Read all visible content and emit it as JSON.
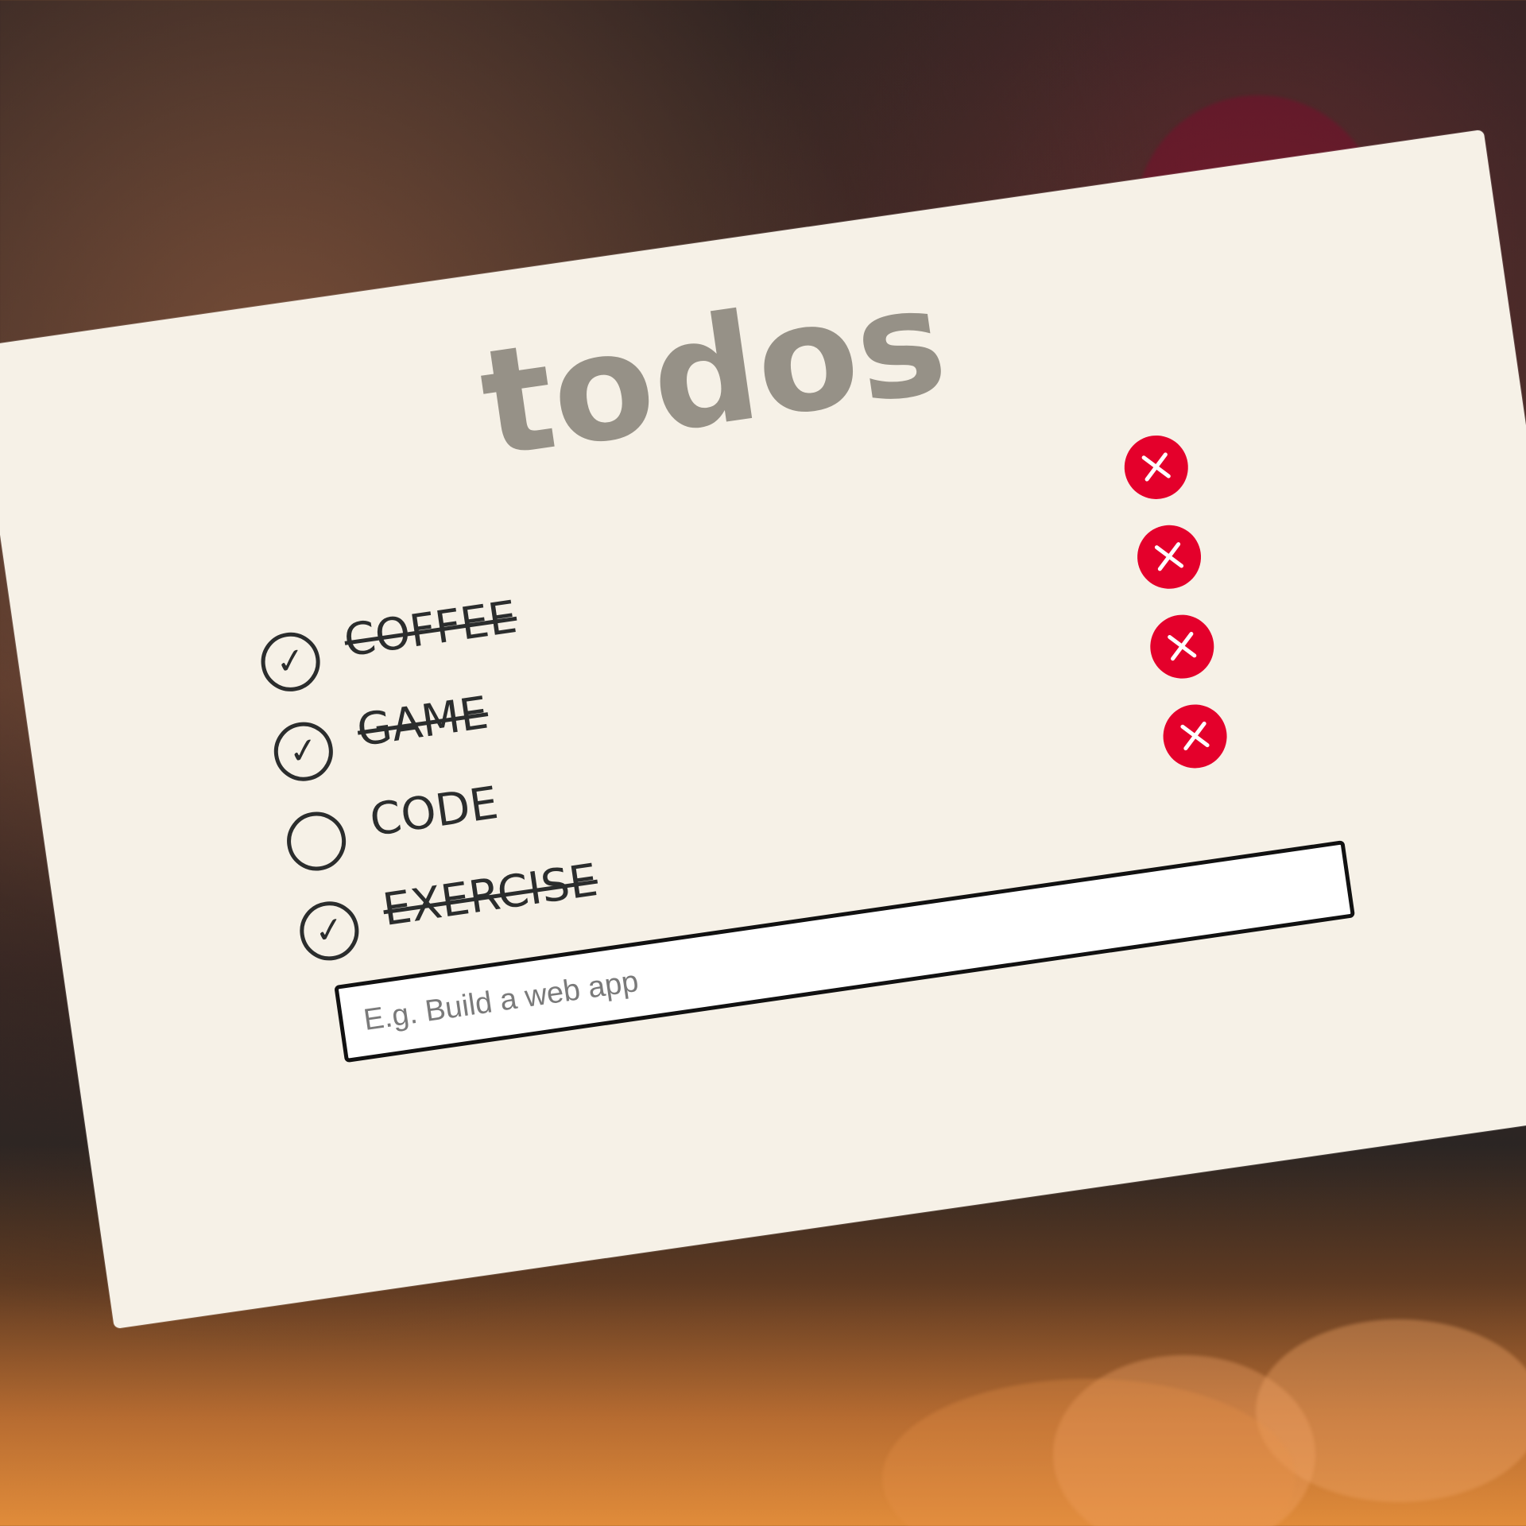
{
  "app": {
    "title": "todos"
  },
  "todos": [
    {
      "label": "COFFEE",
      "completed": true,
      "check_icon": "checkmark-icon",
      "delete_icon": "close-icon"
    },
    {
      "label": "GAME",
      "completed": true,
      "check_icon": "checkmark-icon",
      "delete_icon": "close-icon"
    },
    {
      "label": "CODE",
      "completed": false,
      "check_icon": "empty-circle-icon",
      "delete_icon": "close-icon"
    },
    {
      "label": "EXERCISE",
      "completed": true,
      "check_icon": "checkmark-icon",
      "delete_icon": "close-icon"
    }
  ],
  "input": {
    "value": "",
    "placeholder": "E.g. Build a web app"
  },
  "colors": {
    "card": "#f6f1e7",
    "title": "#969187",
    "text": "#2b2d2d",
    "delete": "#e4002b",
    "input_border": "#111111"
  }
}
